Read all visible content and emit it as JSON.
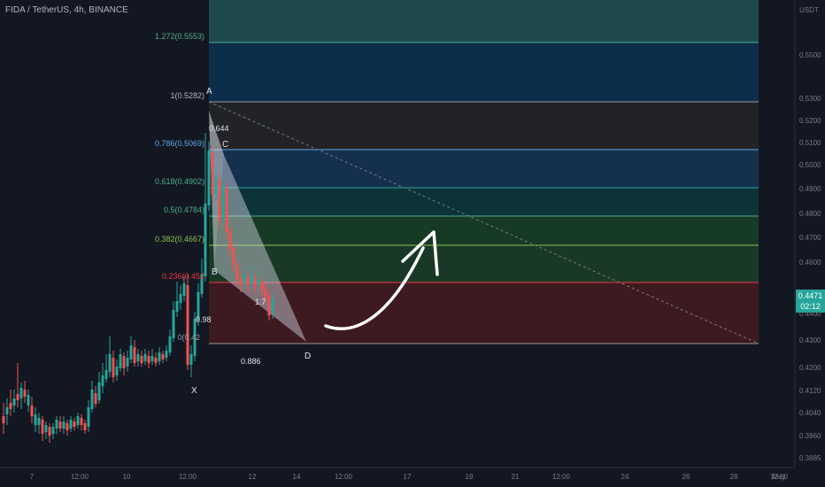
{
  "header": {
    "symbol_title": "FIDA / TetherUS, 4h, BINANCE"
  },
  "price_axis": {
    "currency": "USDT",
    "ticks": [
      "0.5500",
      "0.5300",
      "0.5200",
      "0.5100",
      "0.5000",
      "0.4900",
      "0.4800",
      "0.4700",
      "0.4600",
      "0.4400",
      "0.4300",
      "0.4200",
      "0.4120",
      "0.4040",
      "0.3960",
      "0.3885"
    ],
    "last_price": "0.4471",
    "countdown": "02:12",
    "last_price_color": "#26a69a"
  },
  "time_axis": {
    "ticks": [
      "7",
      "12:00",
      "10",
      "12:00",
      "12",
      "14",
      "12:00",
      "17",
      "19",
      "21",
      "12:00",
      "24",
      "26",
      "28",
      "12:00",
      "May"
    ]
  },
  "fib_levels": [
    {
      "label": "1.272(0.5553)",
      "value": 0.5553,
      "color": "#4caf8d"
    },
    {
      "label": "1(0.5282)",
      "value": 0.5282,
      "color": "#9598a1"
    },
    {
      "label": "0.786(0.5069)",
      "value": 0.5069,
      "color": "#5fa8e8"
    },
    {
      "label": "0.618(0.4902)",
      "value": 0.4902,
      "color": "#4caf8d"
    },
    {
      "label": "0.5(0.4784)",
      "value": 0.4784,
      "color": "#4caf8d"
    },
    {
      "label": "0.382(0.4667)",
      "value": 0.4667,
      "color": "#8bc34a"
    },
    {
      "label": "0.236(0.452",
      "value": 0.4521,
      "color": "#f23645"
    },
    {
      "label": "0(0.42",
      "value": 0.428,
      "color": "#9598a1"
    }
  ],
  "pattern": {
    "points": {
      "X": "X",
      "A": "A",
      "B": "B",
      "C": "C",
      "D": "D"
    },
    "ratios": {
      "xa_top": "0.644",
      "b_ratio": "0.98",
      "cd_ratio": "1.7",
      "xd_ratio": "0.886"
    }
  },
  "colors": {
    "background": "#131722",
    "bull": "#26a69a",
    "bear": "#ef5350",
    "trendline": "#787b86"
  }
}
